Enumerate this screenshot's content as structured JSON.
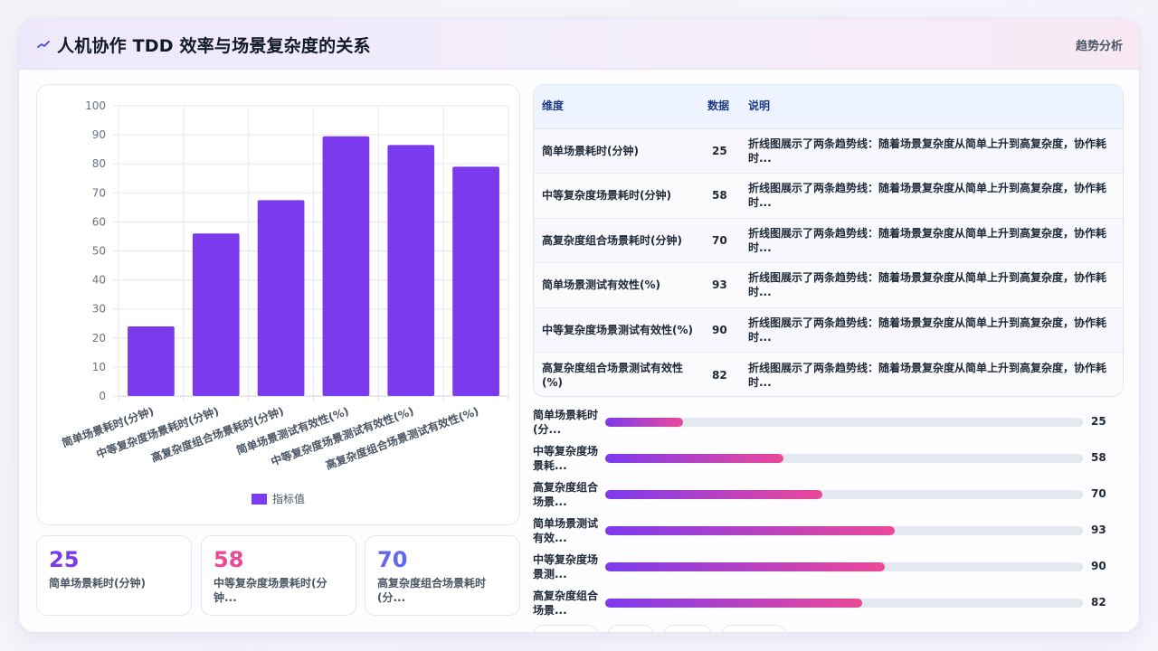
{
  "header": {
    "title": "人机协作 TDD 效率与场景复杂度的关系",
    "tag": "趋势分析"
  },
  "colors": {
    "bar": "#7c3aed",
    "stat1": "#7c3aed",
    "stat2": "#ec4899",
    "stat3": "#6366f1"
  },
  "chart_data": {
    "type": "bar",
    "categories": [
      "简单场景耗时(分钟)",
      "中等复杂度场景耗时(分钟)",
      "高复杂度组合场景耗时(分钟)",
      "简单场景测试有效性(%)",
      "中等复杂度场景测试有效性(%)",
      "高复杂度组合场景测试有效性(%)"
    ],
    "series": [
      {
        "name": "指标值",
        "values": [
          24,
          56,
          67.5,
          89.5,
          86.5,
          79
        ]
      }
    ],
    "ylim": [
      0,
      100
    ],
    "yticks": [
      0,
      10,
      20,
      30,
      40,
      50,
      60,
      70,
      80,
      90,
      100
    ],
    "grid": true,
    "legend": "bottom"
  },
  "stats": [
    {
      "value": "25",
      "label": "简单场景耗时(分钟)"
    },
    {
      "value": "58",
      "label": "中等复杂度场景耗时(分钟..."
    },
    {
      "value": "70",
      "label": "高复杂度组合场景耗时(分..."
    }
  ],
  "table": {
    "headers": [
      "维度",
      "数据",
      "说明"
    ],
    "rows": [
      [
        "简单场景耗时(分钟)",
        "25",
        "折线图展示了两条趋势线：随着场景复杂度从简单上升到高复杂度，协作耗时..."
      ],
      [
        "中等复杂度场景耗时(分钟)",
        "58",
        "折线图展示了两条趋势线：随着场景复杂度从简单上升到高复杂度，协作耗时..."
      ],
      [
        "高复杂度组合场景耗时(分钟)",
        "70",
        "折线图展示了两条趋势线：随着场景复杂度从简单上升到高复杂度，协作耗时..."
      ],
      [
        "简单场景测试有效性(%)",
        "93",
        "折线图展示了两条趋势线：随着场景复杂度从简单上升到高复杂度，协作耗时..."
      ],
      [
        "中等复杂度场景测试有效性(%)",
        "90",
        "折线图展示了两条趋势线：随着场景复杂度从简单上升到高复杂度，协作耗时..."
      ],
      [
        "高复杂度组合场景测试有效性(%)",
        "82",
        "折线图展示了两条趋势线：随着场景复杂度从简单上升到高复杂度，协作耗时..."
      ]
    ]
  },
  "progress": [
    {
      "label": "简单场景耗时(分...",
      "value": "25",
      "percent": 16.2
    },
    {
      "label": "中等复杂度场景耗...",
      "value": "58",
      "percent": 37.3
    },
    {
      "label": "高复杂度组合场景...",
      "value": "70",
      "percent": 45.5
    },
    {
      "label": "简单场景测试有效...",
      "value": "93",
      "percent": 60.6
    },
    {
      "label": "中等复杂度场景测...",
      "value": "90",
      "percent": 58.5
    },
    {
      "label": "高复杂度组合场景...",
      "value": "82",
      "percent": 53.7
    }
  ]
}
